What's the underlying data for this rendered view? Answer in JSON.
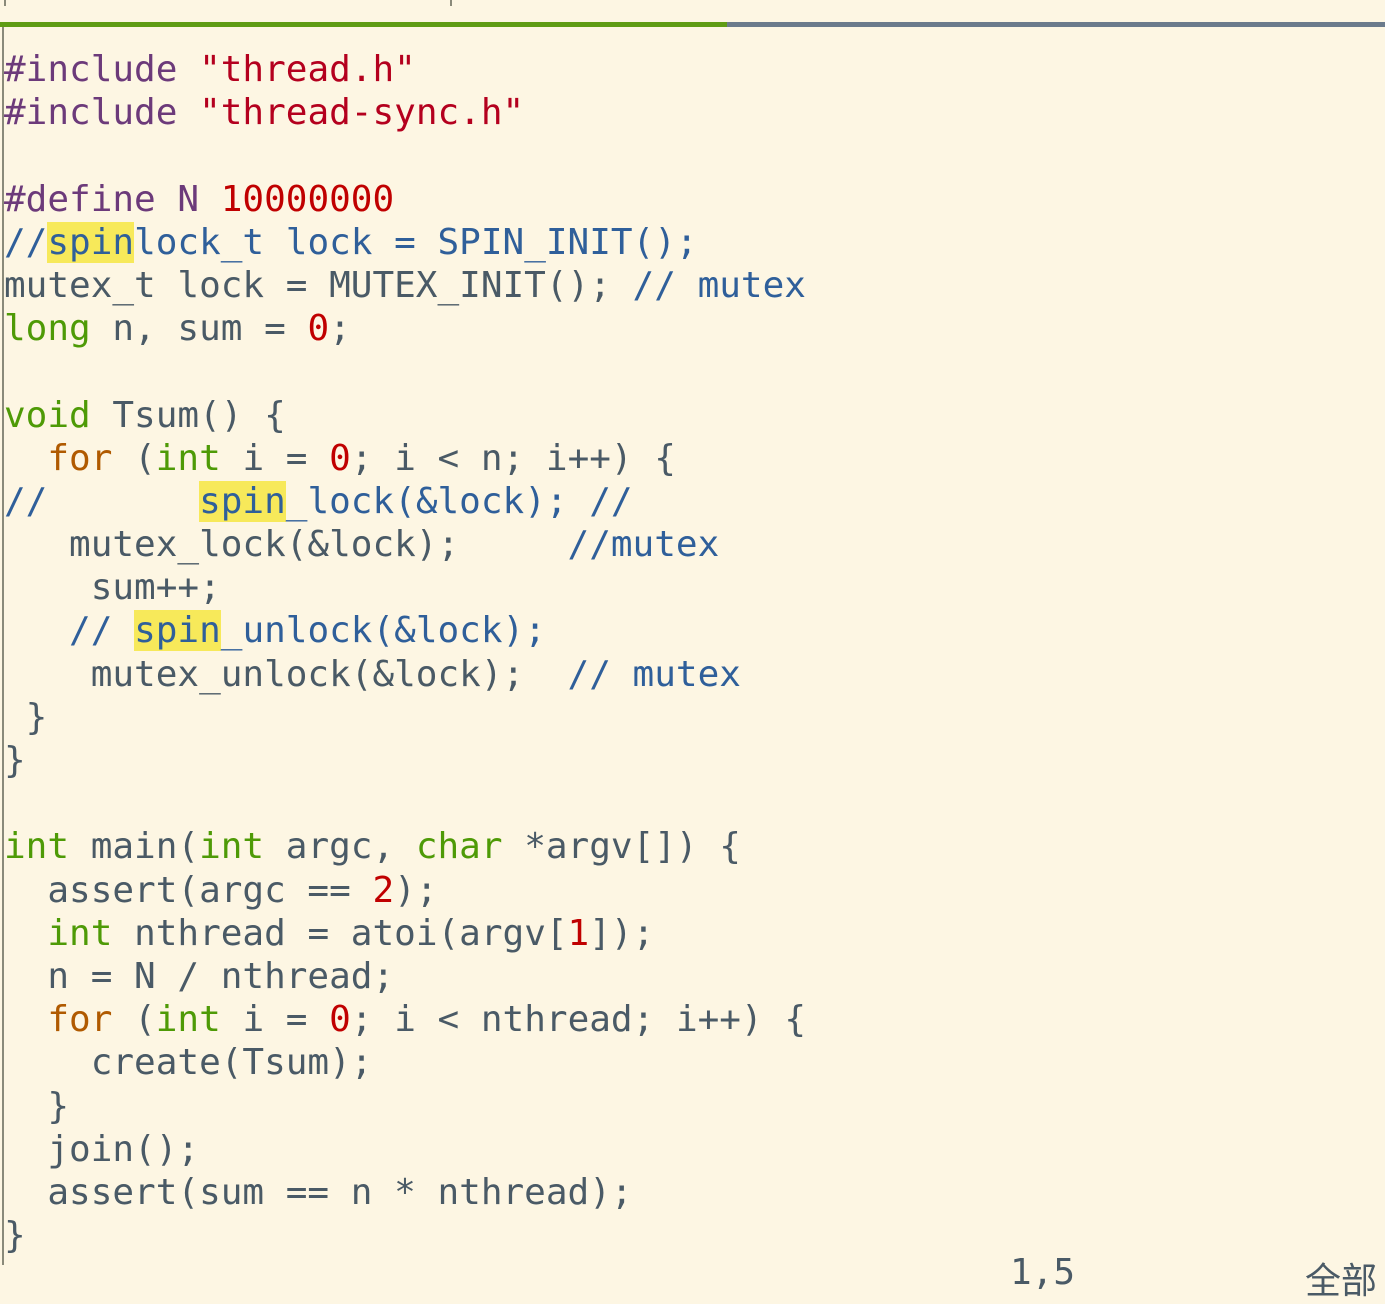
{
  "editor": {
    "scroll_fraction": 0.525,
    "lines": [
      [
        [
          "pp",
          "#include "
        ],
        [
          "str",
          "\"thread.h\""
        ]
      ],
      [
        [
          "pp",
          "#include "
        ],
        [
          "str",
          "\"thread-sync.h\""
        ]
      ],
      [],
      [
        [
          "pp",
          "#define N "
        ],
        [
          "num",
          "10000000"
        ]
      ],
      [
        [
          "cmt",
          "//"
        ],
        [
          "cmt hl",
          "spin"
        ],
        [
          "cmt",
          "lock_t lock = SPIN_INIT();"
        ]
      ],
      [
        [
          "",
          "mutex_t lock = MUTEX_INIT(); "
        ],
        [
          "cmt",
          "// mutex"
        ]
      ],
      [
        [
          "kw",
          "long"
        ],
        [
          "",
          " n, sum = "
        ],
        [
          "num",
          "0"
        ],
        [
          "",
          ";"
        ]
      ],
      [],
      [
        [
          "kw",
          "void"
        ],
        [
          "",
          " Tsum() {"
        ]
      ],
      [
        [
          "",
          "  "
        ],
        [
          "kw2",
          "for"
        ],
        [
          "",
          " ("
        ],
        [
          "kw",
          "int"
        ],
        [
          "",
          " i = "
        ],
        [
          "num",
          "0"
        ],
        [
          "",
          "; i < n; i++) {"
        ]
      ],
      [
        [
          "cmt",
          "//       "
        ],
        [
          "cmt hl",
          "spin"
        ],
        [
          "cmt",
          "_lock(&lock); //"
        ]
      ],
      [
        [
          "",
          "   mutex_lock(&lock);     "
        ],
        [
          "cmt",
          "//mutex"
        ]
      ],
      [
        [
          "",
          "    sum++;"
        ]
      ],
      [
        [
          "",
          "   "
        ],
        [
          "cmt",
          "// "
        ],
        [
          "cmt hl",
          "spin"
        ],
        [
          "cmt",
          "_unlock(&lock);"
        ]
      ],
      [
        [
          "",
          "    mutex_unlock(&lock);  "
        ],
        [
          "cmt",
          "// mutex"
        ]
      ],
      [
        [
          "",
          " }"
        ]
      ],
      [
        [
          "",
          "}"
        ]
      ],
      [],
      [
        [
          "kw",
          "int"
        ],
        [
          "",
          " main("
        ],
        [
          "kw",
          "int"
        ],
        [
          "",
          " argc, "
        ],
        [
          "kw",
          "char"
        ],
        [
          "",
          " *argv[]) {"
        ]
      ],
      [
        [
          "",
          "  assert(argc == "
        ],
        [
          "num",
          "2"
        ],
        [
          "",
          ");"
        ]
      ],
      [
        [
          "",
          "  "
        ],
        [
          "kw",
          "int"
        ],
        [
          "",
          " nthread = atoi(argv["
        ],
        [
          "num",
          "1"
        ],
        [
          "",
          "]);"
        ]
      ],
      [
        [
          "",
          "  n = N / nthread;"
        ]
      ],
      [
        [
          "",
          "  "
        ],
        [
          "kw2",
          "for"
        ],
        [
          "",
          " ("
        ],
        [
          "kw",
          "int"
        ],
        [
          "",
          " i = "
        ],
        [
          "num",
          "0"
        ],
        [
          "",
          "; i < nthread; i++) {"
        ]
      ],
      [
        [
          "",
          "    create(Tsum);"
        ]
      ],
      [
        [
          "",
          "  }"
        ]
      ],
      [
        [
          "",
          "  join();"
        ]
      ],
      [
        [
          "",
          "  assert(sum == n * nthread);"
        ]
      ],
      [
        [
          "",
          "}"
        ]
      ]
    ]
  },
  "status": {
    "position": "1,5",
    "scroll": "全部"
  }
}
